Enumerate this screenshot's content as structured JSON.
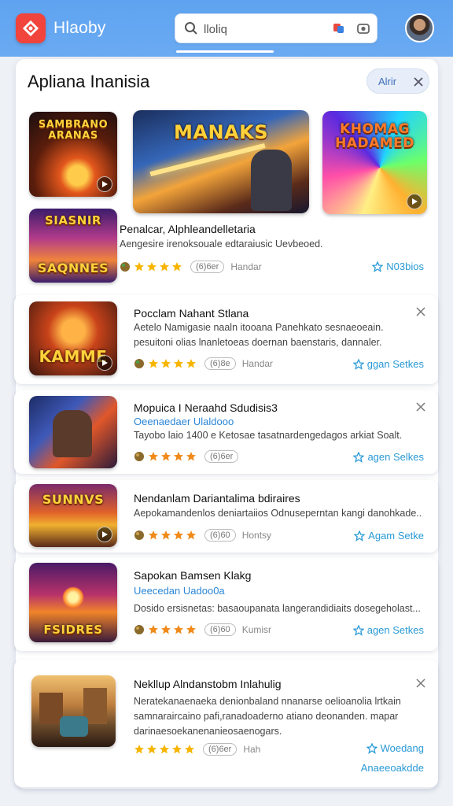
{
  "header": {
    "app_title": "Hlaoby",
    "search_value": "lloliq",
    "search_placeholder": "lloliq"
  },
  "panel": {
    "title": "Apliana Inanisia",
    "filter_label": "Alrir"
  },
  "thumbs": {
    "t1": "SAMBRANO ARANAS",
    "t2": "MANAKS",
    "t3": "KHOMAG HADAMED",
    "t4a": "SIASNIR",
    "t4b": "SAQNNES",
    "t5": "KAMME",
    "t7": "SUNNVS",
    "t8": "FSIDRES"
  },
  "featured": {
    "title": "Penalcar, Alphleandelletaria",
    "desc": "Aengesire irenoksouale edtaraiusic Uevbeoed.",
    "rating_pill": "(6)6er",
    "meta": "Handar",
    "action": "N03bios"
  },
  "cards": [
    {
      "title": "Pocclam Nahant Stlana",
      "desc1": "Aetelo Namigasie naaln itooana Panehkato sesnaeoeain.",
      "desc2": "pesuitoni olias lnanletoeas doernan baenstaris, dannaler.",
      "rating_pill": "(6)8e",
      "meta": "Handar",
      "action": "ggan Setkes"
    },
    {
      "title": "Mopuica I Neraahd Sdudisis3",
      "sub": "Oeenaedaer Ulaldooo",
      "desc1": "Tayobo laio 1400 e Ketosae tasatnardengedagos arkiat Soalt.",
      "rating_pill": "(6)6er",
      "action": "agen Selkes"
    },
    {
      "title": "Nendanlam Dariantalima bdiraires",
      "desc1": "Aepokamandenlos deniartaiios Odnuseperntan kangi danohkade..",
      "rating_pill": "(6)60",
      "meta": "Hontsy",
      "action": "Agam Setke"
    },
    {
      "title": "Sapokan Bamsen Klakg",
      "sub": "Ueecedan Uadoo0a",
      "desc1": "Dosido ersisnetas: basaoupanata langerandidiaits dosegeholast...",
      "rating_pill": "(6)60",
      "meta": "Kumisr",
      "action": "agen Setkes"
    },
    {
      "title": "Nekllup Alndanstobm Inlahulig",
      "desc1": "Neratekanaenaeka denionbaland nnanarse oelioanolia lrtkain",
      "desc2": "samnaraircaino pafi,ranadoaderno atiano deonanden. mapar",
      "desc3": "darinaesoekanenanieosaenogars.",
      "rating_pill": "(6)6er",
      "meta": "Hah",
      "action": "Woedang",
      "action2": "Anaeeoakdde"
    }
  ],
  "colors": {
    "topbar": "#6aaaf2",
    "accent_link": "#2a9ad6",
    "star": "#f7b500",
    "logo": "#f0443c"
  }
}
